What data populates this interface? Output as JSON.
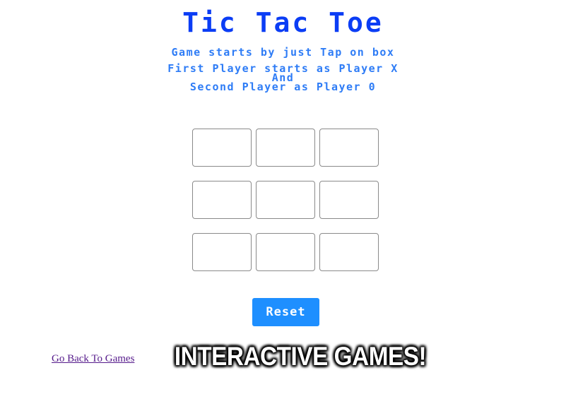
{
  "title": "Tic Tac Toe",
  "instructions": {
    "line1": "Game starts by just Tap on box",
    "line2_prefix": "First Player starts as ",
    "line2_player": "Player X",
    "line3": "And",
    "line4_prefix": "Second Player as ",
    "line4_player": "Player 0"
  },
  "board": {
    "cells": [
      "",
      "",
      "",
      "",
      "",
      "",
      "",
      "",
      ""
    ]
  },
  "reset_label": "Reset",
  "back_link_label": "Go Back To Games",
  "banner_text": "INTERACTIVE GAMES!",
  "colors": {
    "title": "#0b3df5",
    "instructions": "#2e7cf6",
    "reset_button": "#1e8fff",
    "cell_border": "#8a8a8a",
    "link": "#551a8b"
  }
}
